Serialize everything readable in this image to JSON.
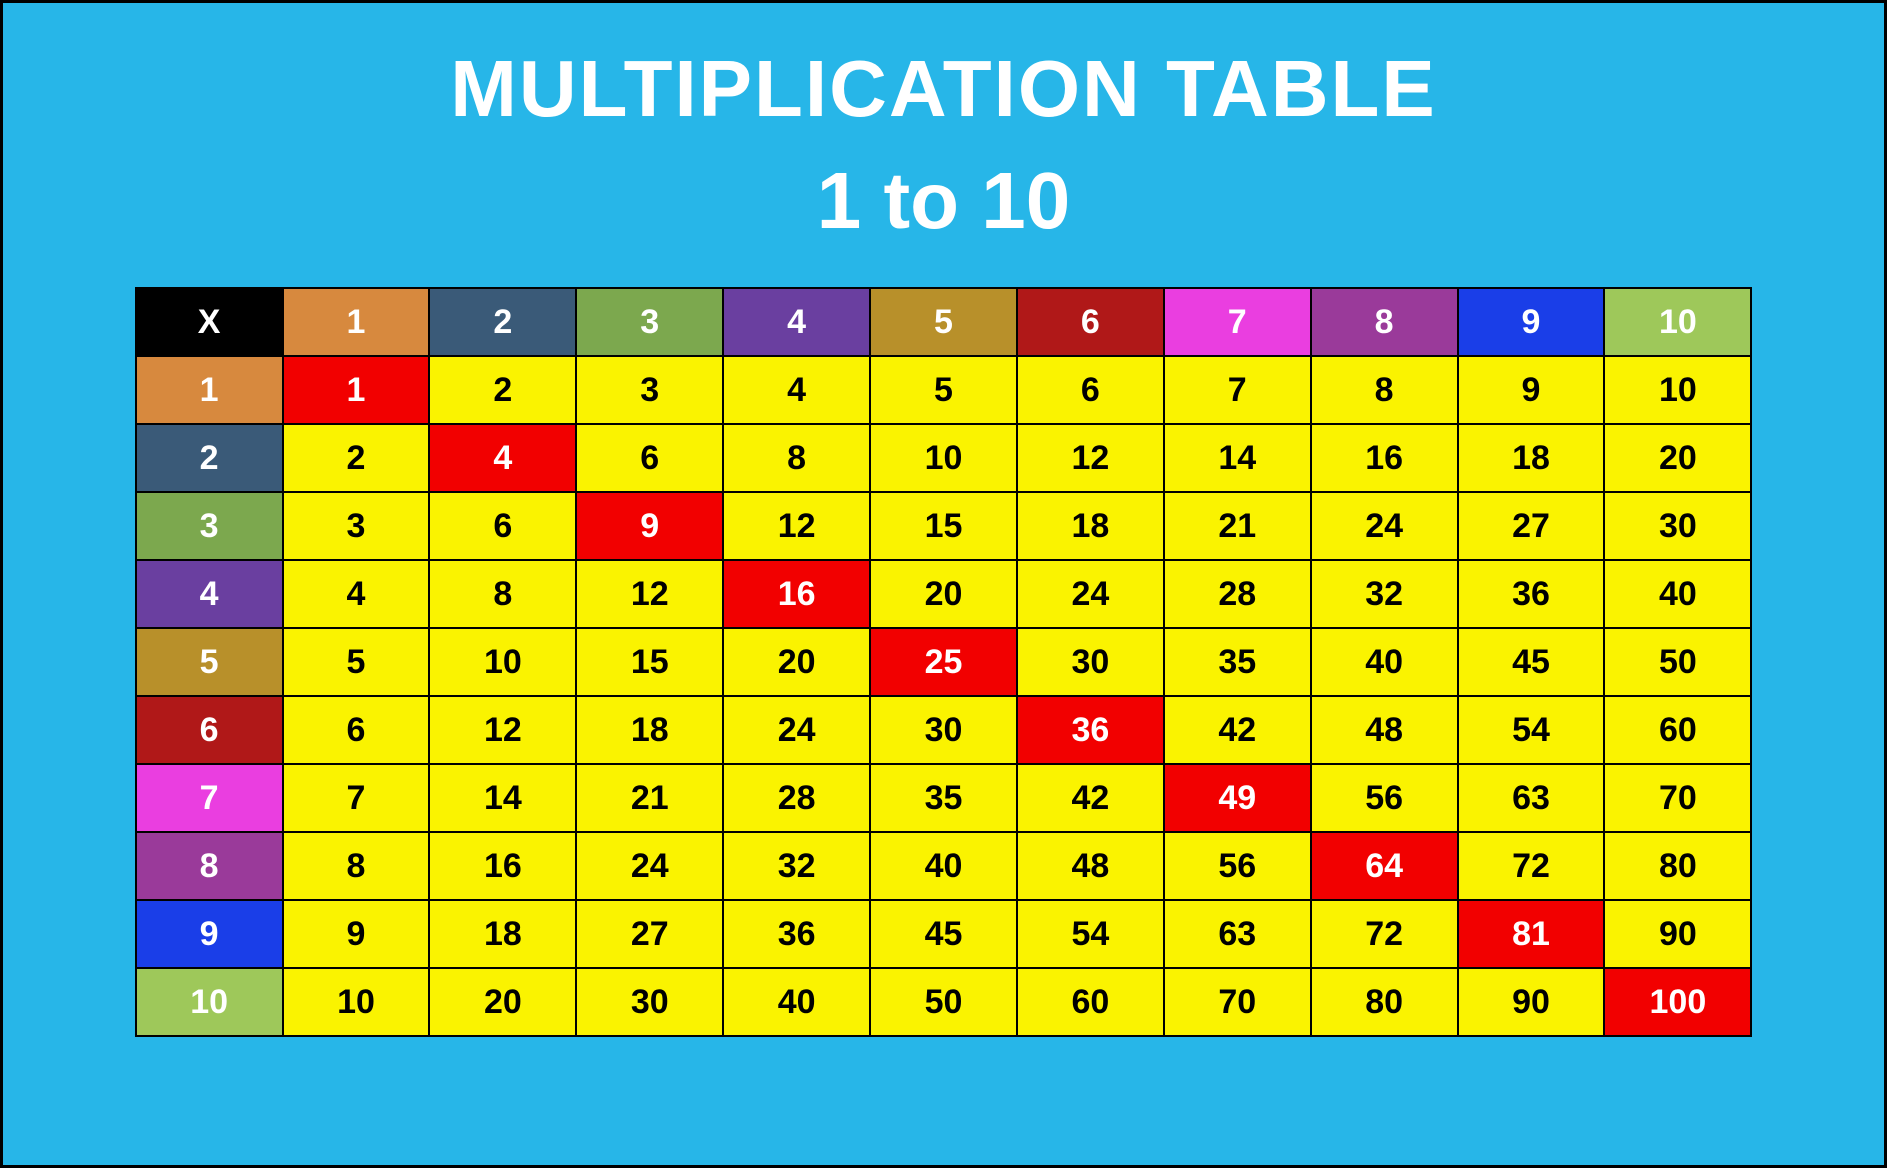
{
  "title": "MULTIPLICATION TABLE",
  "subtitle": "1 to 10",
  "corner": "X",
  "headers": [
    "1",
    "2",
    "3",
    "4",
    "5",
    "6",
    "7",
    "8",
    "9",
    "10"
  ],
  "header_colors": [
    "bg-orange",
    "bg-navy",
    "bg-olive",
    "bg-purple",
    "bg-gold",
    "bg-darkred",
    "bg-magenta",
    "bg-plum",
    "bg-blue",
    "bg-lime"
  ],
  "chart_data": {
    "type": "table",
    "title": "Multiplication Table 1 to 10",
    "row_labels": [
      1,
      2,
      3,
      4,
      5,
      6,
      7,
      8,
      9,
      10
    ],
    "col_labels": [
      1,
      2,
      3,
      4,
      5,
      6,
      7,
      8,
      9,
      10
    ],
    "values": [
      [
        1,
        2,
        3,
        4,
        5,
        6,
        7,
        8,
        9,
        10
      ],
      [
        2,
        4,
        6,
        8,
        10,
        12,
        14,
        16,
        18,
        20
      ],
      [
        3,
        6,
        9,
        12,
        15,
        18,
        21,
        24,
        27,
        30
      ],
      [
        4,
        8,
        12,
        16,
        20,
        24,
        28,
        32,
        36,
        40
      ],
      [
        5,
        10,
        15,
        20,
        25,
        30,
        35,
        40,
        45,
        50
      ],
      [
        6,
        12,
        18,
        24,
        30,
        36,
        42,
        48,
        54,
        60
      ],
      [
        7,
        14,
        21,
        28,
        35,
        42,
        49,
        56,
        63,
        70
      ],
      [
        8,
        16,
        24,
        32,
        40,
        48,
        56,
        64,
        72,
        80
      ],
      [
        9,
        18,
        27,
        36,
        45,
        54,
        63,
        72,
        81,
        90
      ],
      [
        10,
        20,
        30,
        40,
        50,
        60,
        70,
        80,
        90,
        100
      ]
    ]
  }
}
